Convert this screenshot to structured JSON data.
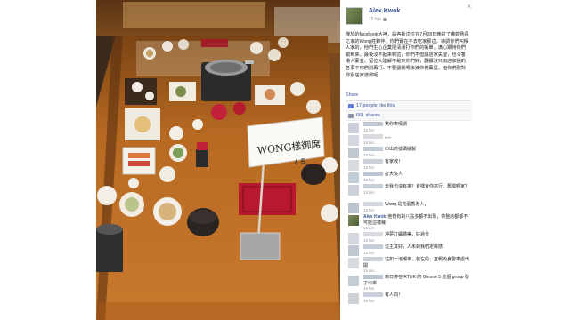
{
  "window": {
    "close_glyph": "×"
  },
  "post": {
    "author": "Alex Kwok",
    "time": "15 hrs",
    "text": "僅於的facebook大神，請各新這位在7月28日晚訂了佛蛇熟長之家的Wong姓夥伴，你們實在不去吃家那這，導調你們叫帳人家的，他們生心企業把清湯打你們的帳單，滿心期待你們跟到來，最後沒不起來到這，你們不但讓店家失望，也令香港人蒙羞。留位大陸解不是只你們好，翻讀沒只雨店家說的各事下你們別再打，不要讓我嗎後被你們奧蛋，但你們別對你別店家道歉呢",
    "share_label": "Share",
    "photo_sign_text": "WONG樣御席",
    "photo_sign_sub": "4 名"
  },
  "summary": {
    "likes": "17 people like this.",
    "shares": "661 shares"
  },
  "comments": [
    {
      "text": "幫你表嘆謂",
      "time": "15 hrs"
    },
    {
      "text": "。。。",
      "time": "15 hrs"
    },
    {
      "text": "印出的號碼據製",
      "time": "15 hrs"
    },
    {
      "text": "有家教！",
      "time": "15 hrs"
    },
    {
      "text": "訂大沒人",
      "time": "15 hrs"
    },
    {
      "text": "去我也沒有來？會嘿會你來行，舊嘿啊家？",
      "time": "15 hrs"
    },
    {
      "text": "Wong 是完蛋香港人，",
      "time": "15 hrs"
    },
    {
      "name": "Alex Kwok",
      "text": "他們有對八點多都不出現，你整店都都不可能這樣幾",
      "time": "15 hrs"
    },
    {
      "text": "沖夢訂攝體美，好過分",
      "time": "15 hrs"
    },
    {
      "text": "這主其好，人未對我們定絲感",
      "time": "15 hrs"
    },
    {
      "text": "這如一池潮來，包左的，直報內食警車處出開",
      "time": "15 hrs"
    },
    {
      "text": "到日排在 RTHK 的 Gimme 5 這個 group 發了出來",
      "time": "15 hrs"
    },
    {
      "text": "有人問！",
      "time": "15 hrs"
    }
  ],
  "colors": {
    "fb_blue": "#3b5998",
    "meta_gray": "#9197a3",
    "table_wood": "#b0661f",
    "placemat_red": "#b8192e"
  }
}
